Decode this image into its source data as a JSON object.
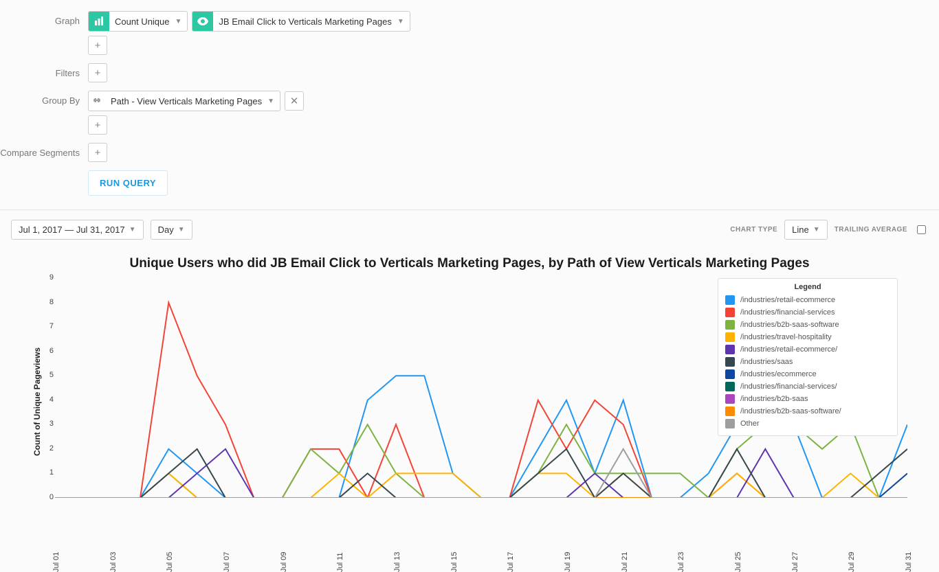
{
  "labels": {
    "graph": "Graph",
    "filters": "Filters",
    "group_by": "Group By",
    "compare_segments": "Compare Segments",
    "run_query": "RUN QUERY",
    "chart_type": "CHART TYPE",
    "trailing_average": "TRAILING AVERAGE",
    "legend": "Legend"
  },
  "graph_pill": {
    "metric": "Count Unique",
    "event": "JB Email Click to Verticals Marketing Pages"
  },
  "group_by_pill": "Path - View Verticals Marketing Pages",
  "date_range": "Jul 1, 2017 — Jul 31, 2017",
  "granularity": "Day",
  "chart_type_value": "Line",
  "chart_title": "Unique Users who did JB Email Click to Verticals Marketing Pages, by Path of View Verticals Marketing Pages",
  "ylabel": "Count of Unique Pageviews",
  "chart_data": {
    "type": "line",
    "xlabel": "",
    "ylabel": "Count of Unique Pageviews",
    "ylim": [
      0,
      9
    ],
    "x": [
      "Jul 01",
      "Jul 02",
      "Jul 03",
      "Jul 04",
      "Jul 05",
      "Jul 06",
      "Jul 07",
      "Jul 08",
      "Jul 09",
      "Jul 10",
      "Jul 11",
      "Jul 12",
      "Jul 13",
      "Jul 14",
      "Jul 15",
      "Jul 16",
      "Jul 17",
      "Jul 18",
      "Jul 19",
      "Jul 20",
      "Jul 21",
      "Jul 22",
      "Jul 23",
      "Jul 24",
      "Jul 25",
      "Jul 26",
      "Jul 27",
      "Jul 28",
      "Jul 29",
      "Jul 30",
      "Jul 31"
    ],
    "x_ticks": [
      "Jul 01",
      "Jul 03",
      "Jul 05",
      "Jul 07",
      "Jul 09",
      "Jul 11",
      "Jul 13",
      "Jul 15",
      "Jul 17",
      "Jul 19",
      "Jul 21",
      "Jul 23",
      "Jul 25",
      "Jul 27",
      "Jul 29",
      "Jul 31"
    ],
    "series": [
      {
        "name": "/industries/retail-ecommerce",
        "color": "#2196f3",
        "values": [
          0,
          0,
          0,
          0,
          2,
          1,
          0,
          0,
          0,
          0,
          0,
          4,
          5,
          5,
          1,
          0,
          0,
          2,
          4,
          1,
          4,
          0,
          0,
          1,
          3,
          6,
          3,
          0,
          0,
          0,
          3
        ]
      },
      {
        "name": "/industries/financial-services",
        "color": "#f44336",
        "values": [
          0,
          0,
          0,
          0,
          8,
          5,
          3,
          0,
          0,
          2,
          2,
          0,
          3,
          0,
          0,
          0,
          0,
          4,
          2,
          4,
          3,
          0,
          0,
          0,
          1,
          0,
          0,
          0,
          0,
          0,
          0
        ]
      },
      {
        "name": "/industries/b2b-saas-software",
        "color": "#7cb342",
        "values": [
          0,
          0,
          0,
          0,
          1,
          0,
          0,
          0,
          0,
          2,
          1,
          3,
          1,
          0,
          0,
          0,
          0,
          1,
          3,
          1,
          1,
          1,
          1,
          0,
          2,
          3,
          3,
          2,
          3,
          0,
          0
        ]
      },
      {
        "name": "/industries/travel-hospitality",
        "color": "#ffb300",
        "values": [
          0,
          0,
          0,
          0,
          1,
          0,
          0,
          0,
          0,
          0,
          1,
          0,
          1,
          1,
          1,
          0,
          0,
          1,
          1,
          0,
          1,
          0,
          0,
          0,
          1,
          0,
          0,
          0,
          1,
          0,
          0
        ]
      },
      {
        "name": "/industries/retail-ecommerce/",
        "color": "#5e35b1",
        "values": [
          0,
          0,
          0,
          0,
          0,
          1,
          2,
          0,
          0,
          0,
          0,
          0,
          0,
          0,
          0,
          0,
          0,
          0,
          0,
          1,
          0,
          0,
          0,
          0,
          0,
          2,
          0,
          0,
          0,
          0,
          0
        ]
      },
      {
        "name": "/industries/saas",
        "color": "#37474f",
        "values": [
          0,
          0,
          0,
          0,
          1,
          2,
          0,
          0,
          0,
          0,
          0,
          1,
          0,
          0,
          0,
          0,
          0,
          1,
          2,
          0,
          1,
          0,
          0,
          0,
          2,
          0,
          0,
          0,
          0,
          1,
          2
        ]
      },
      {
        "name": "/industries/ecommerce",
        "color": "#0d47a1",
        "values": [
          0,
          0,
          0,
          0,
          0,
          0,
          0,
          0,
          0,
          0,
          0,
          0,
          0,
          0,
          0,
          0,
          0,
          0,
          0,
          0,
          0,
          0,
          0,
          0,
          0,
          0,
          0,
          0,
          0,
          0,
          1
        ]
      },
      {
        "name": "/industries/financial-services/",
        "color": "#00695c",
        "values": [
          0,
          0,
          0,
          0,
          0,
          0,
          0,
          0,
          0,
          0,
          0,
          0,
          0,
          0,
          0,
          0,
          0,
          0,
          0,
          0,
          0,
          0,
          0,
          0,
          0,
          0,
          0,
          0,
          0,
          0,
          0
        ]
      },
      {
        "name": "/industries/b2b-saas",
        "color": "#ab47bc",
        "values": [
          0,
          0,
          0,
          0,
          0,
          0,
          0,
          0,
          0,
          0,
          0,
          0,
          0,
          0,
          0,
          0,
          0,
          0,
          0,
          0,
          0,
          0,
          0,
          0,
          0,
          0,
          0,
          0,
          0,
          0,
          0
        ]
      },
      {
        "name": "/industries/b2b-saas-software/",
        "color": "#fb8c00",
        "values": [
          0,
          0,
          0,
          0,
          0,
          0,
          0,
          0,
          0,
          0,
          0,
          0,
          0,
          0,
          0,
          0,
          0,
          0,
          0,
          0,
          0,
          0,
          0,
          0,
          0,
          0,
          0,
          0,
          0,
          0,
          0
        ]
      },
      {
        "name": "Other",
        "color": "#9e9e9e",
        "values": [
          0,
          0,
          0,
          0,
          0,
          0,
          0,
          0,
          0,
          0,
          0,
          0,
          0,
          0,
          0,
          0,
          0,
          0,
          0,
          0,
          2,
          0,
          0,
          0,
          0,
          0,
          0,
          0,
          0,
          0,
          0
        ]
      }
    ]
  }
}
